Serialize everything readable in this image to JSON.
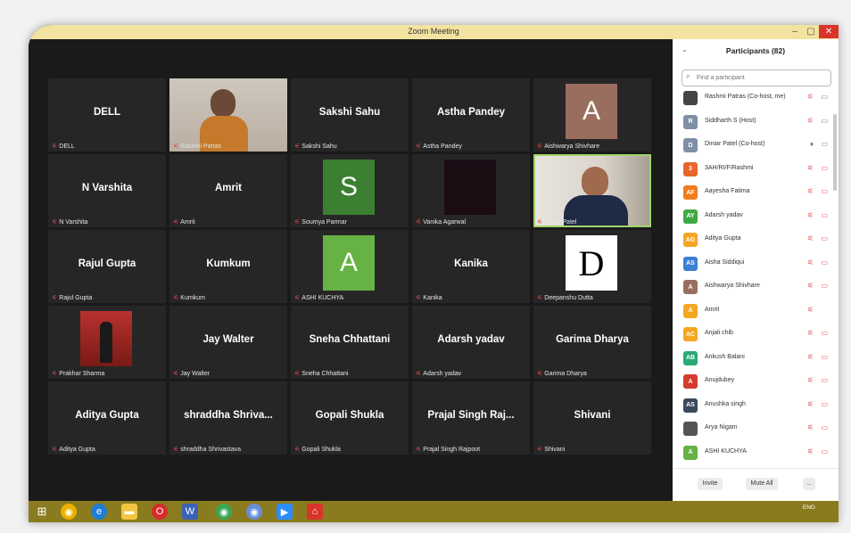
{
  "window": {
    "title": "Zoom Meeting",
    "min": "–",
    "max": "▢",
    "close": "✕"
  },
  "tiles": [
    {
      "big": "DELL",
      "label": "DELL"
    },
    {
      "big": "",
      "label": "Rashmi Patras"
    },
    {
      "big": "Sakshi Sahu",
      "label": "Sakshi Sahu"
    },
    {
      "big": "Astha Pandey",
      "label": "Astha Pandey"
    },
    {
      "big": "",
      "label": "Aishwarya Shivhare",
      "letter": "A"
    },
    {
      "big": "N Varshita",
      "label": "N Varshita"
    },
    {
      "big": "Amrit",
      "label": "Amrit"
    },
    {
      "big": "",
      "label": "Soumya Parmar",
      "letter": "S"
    },
    {
      "big": "",
      "label": "Vanika Agarwal"
    },
    {
      "big": "",
      "label": "Diniar Patel"
    },
    {
      "big": "Rajul Gupta",
      "label": "Rajul Gupta"
    },
    {
      "big": "Kumkum",
      "label": "Kumkum"
    },
    {
      "big": "",
      "label": "ASHI KUCHYA",
      "letter": "A"
    },
    {
      "big": "Kanika",
      "label": "Kanika"
    },
    {
      "big": "",
      "label": "Deepanshu Dutta",
      "letter": "D"
    },
    {
      "big": "",
      "label": "Prakhar Sharma"
    },
    {
      "big": "Jay Walter",
      "label": "Jay Walter"
    },
    {
      "big": "Sneha Chhattani",
      "label": "Sneha Chhattani"
    },
    {
      "big": "Adarsh yadav",
      "label": "Adarsh yadav"
    },
    {
      "big": "Garima Dharya",
      "label": "Garima Dharya"
    },
    {
      "big": "Aditya Gupta",
      "label": "Aditya Gupta"
    },
    {
      "big": "shraddha  Shriva...",
      "label": "shraddha Shrivastava"
    },
    {
      "big": "Gopali Shukla",
      "label": "Gopali Shukla"
    },
    {
      "big": "Prajal Singh Raj...",
      "label": "Prajal Singh Rajpoot"
    },
    {
      "big": "Shivani",
      "label": "Shivani"
    }
  ],
  "panel": {
    "title": "Participants (82)",
    "search_placeholder": "Find a participant",
    "participants": [
      {
        "initials": "",
        "name": "Rashmi Patras (Co-host, me)",
        "color": "#444444",
        "cam": true
      },
      {
        "initials": "R",
        "name": "Siddharth S (Host)",
        "color": "#7f8fa6",
        "cam": true
      },
      {
        "initials": "D",
        "name": "Diniar Patel (Co-host)",
        "color": "#7f8fa6",
        "cam": true,
        "unmuted": true
      },
      {
        "initials": "3",
        "name": "3AH/RI/F/Rashmi",
        "color": "#e8662a",
        "cam": true
      },
      {
        "initials": "AF",
        "name": "Aayesha Fatima",
        "color": "#f07d1e",
        "cam": true
      },
      {
        "initials": "AY",
        "name": "Adarsh yadav",
        "color": "#3eaa46",
        "cam": true
      },
      {
        "initials": "AG",
        "name": "Aditya Gupta",
        "color": "#f5a623",
        "cam": true
      },
      {
        "initials": "AS",
        "name": "Aisha Siddiqui",
        "color": "#3a7fd5",
        "cam": true
      },
      {
        "initials": "A",
        "name": "Aishwarya Shivhare",
        "color": "#9a6e5f",
        "cam": true
      },
      {
        "initials": "A",
        "name": "Amrit",
        "color": "#f5a623",
        "cam": false
      },
      {
        "initials": "AC",
        "name": "Anjali chib",
        "color": "#f5a623",
        "cam": true
      },
      {
        "initials": "AB",
        "name": "Ankush Balani",
        "color": "#2aa876",
        "cam": true
      },
      {
        "initials": "A",
        "name": "Anujdubey",
        "color": "#d63b2e",
        "cam": true
      },
      {
        "initials": "AS",
        "name": "Anushka singh",
        "color": "#3a4a5c",
        "cam": true
      },
      {
        "initials": "",
        "name": "Arya Nigam",
        "color": "#555555",
        "cam": true
      },
      {
        "initials": "A",
        "name": "ASHI KUCHYA",
        "color": "#66b244",
        "cam": true
      }
    ],
    "invite": "Invite",
    "mute_all": "Mute All",
    "more": "..."
  },
  "tray": {
    "lang": "ENG"
  }
}
